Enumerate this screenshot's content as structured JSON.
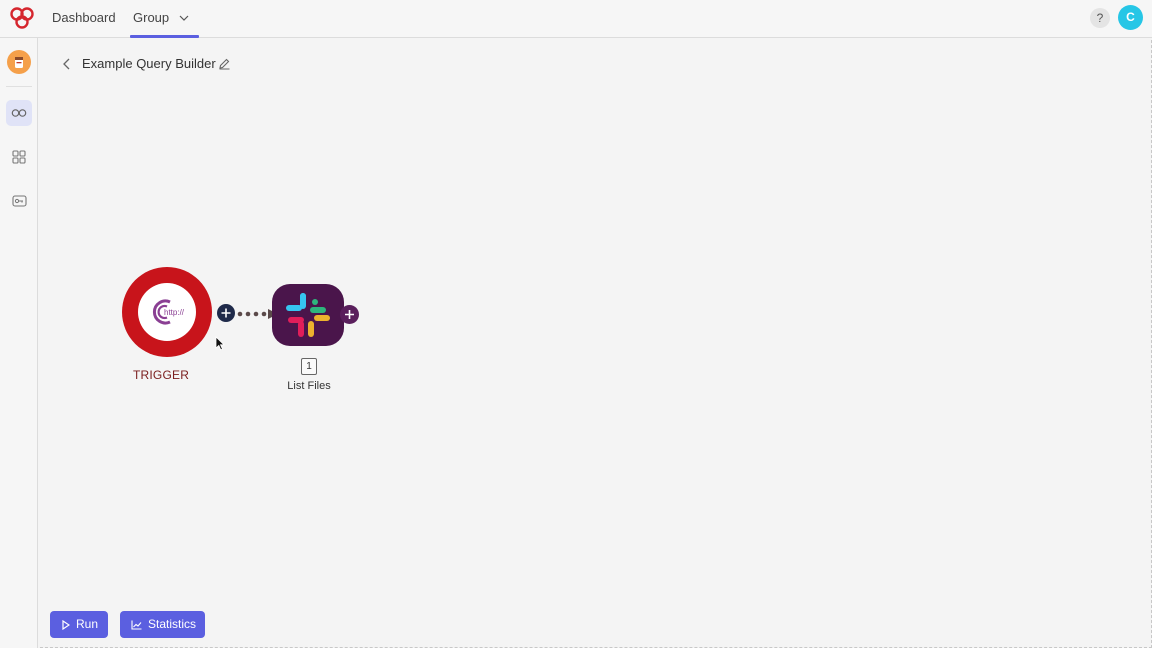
{
  "nav": {
    "dashboard": "Dashboard",
    "group": "Group",
    "help": "?",
    "user_initial": "C"
  },
  "scenario": {
    "title": "Example Query Builder"
  },
  "nodes": {
    "trigger_label": "TRIGGER",
    "trigger_icon_text": "http://",
    "module_badge": "1",
    "module_label": "List Files"
  },
  "toolbar": {
    "run": "Run",
    "statistics": "Statistics"
  },
  "colors": {
    "accent": "#5b5fe0",
    "trigger": "#c8141b",
    "slack_bg": "#4a154b",
    "user_avatar": "#26c6e6"
  }
}
